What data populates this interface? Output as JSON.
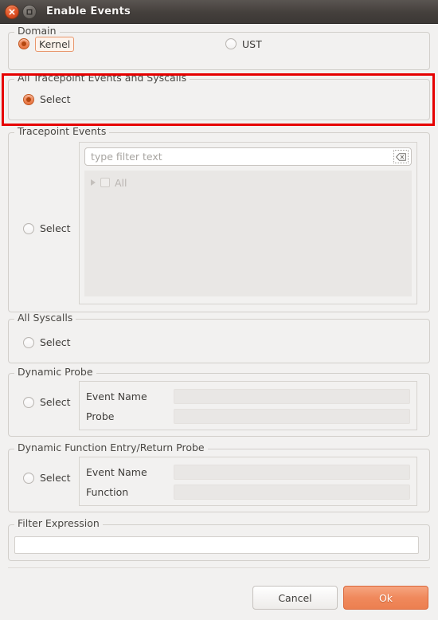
{
  "window": {
    "title": "Enable Events",
    "close_icon": "close-icon",
    "maximize_icon": "maximize-icon"
  },
  "domain": {
    "title": "Domain",
    "options": [
      {
        "label": "Kernel",
        "selected": true,
        "focused": true
      },
      {
        "label": "UST",
        "selected": false,
        "focused": false
      }
    ]
  },
  "all_tracepoints": {
    "title": "All Tracepoint Events and Syscalls",
    "select_label": "Select",
    "selected": true,
    "highlight_color": "#e60000"
  },
  "tracepoint_events": {
    "title": "Tracepoint Events",
    "select_label": "Select",
    "selected": false,
    "filter": {
      "value": "",
      "placeholder": "type filter text",
      "clear_icon": "clear-filter-icon"
    },
    "tree": {
      "rows": [
        {
          "label": "All",
          "expand_icon": "expand-arrow-icon",
          "checked": false,
          "disabled": true
        }
      ]
    }
  },
  "all_syscalls": {
    "title": "All Syscalls",
    "select_label": "Select",
    "selected": false
  },
  "dynamic_probe": {
    "title": "Dynamic Probe",
    "select_label": "Select",
    "selected": false,
    "fields": [
      {
        "label": "Event Name",
        "value": "",
        "disabled": true
      },
      {
        "label": "Probe",
        "value": "",
        "disabled": true
      }
    ]
  },
  "dynamic_function_probe": {
    "title": "Dynamic Function Entry/Return Probe",
    "select_label": "Select",
    "selected": false,
    "fields": [
      {
        "label": "Event Name",
        "value": "",
        "disabled": true
      },
      {
        "label": "Function",
        "value": "",
        "disabled": true
      }
    ]
  },
  "filter_expression": {
    "title": "Filter Expression",
    "value": "",
    "placeholder": ""
  },
  "buttons": {
    "cancel_label": "Cancel",
    "ok_label": "Ok",
    "ok_accent_color": "#ef875a"
  }
}
